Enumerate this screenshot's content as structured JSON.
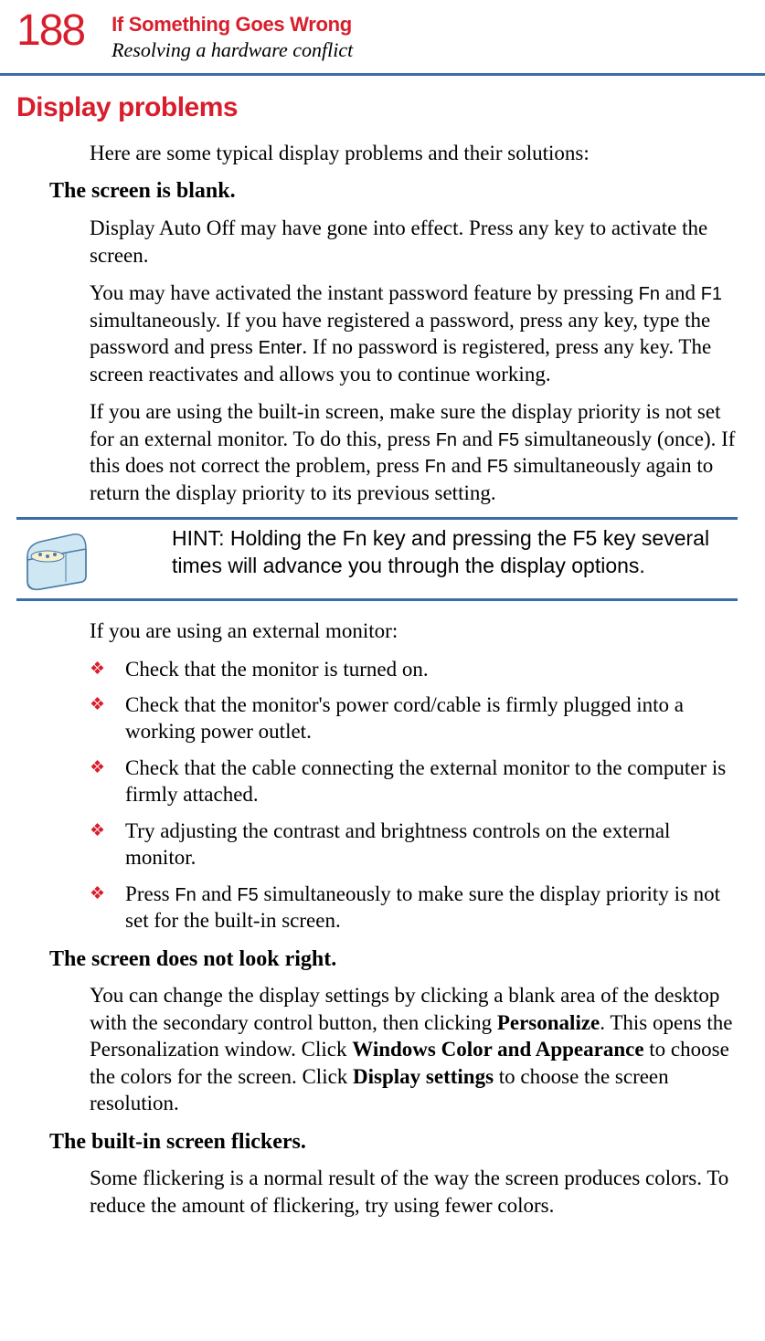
{
  "header": {
    "page_number": "188",
    "chapter_title": "If Something Goes Wrong",
    "section_subtitle": "Resolving a hardware conflict"
  },
  "heading": "Display problems",
  "intro": "Here are some typical display problems and their solutions:",
  "q1": "The screen is blank.",
  "p1": "Display Auto Off may have gone into effect. Press any key to activate the screen.",
  "p2a": "You may have activated the instant password feature by pressing ",
  "p2_fn": "Fn",
  "p2b": " and ",
  "p2_f1": "F1",
  "p2c": " simultaneously. If you have registered a password, press any key, type the password and press ",
  "p2_enter": "Enter",
  "p2d": ". If no password is registered, press any key. The screen reactivates and allows you to continue working.",
  "p3a": "If you are using the built-in screen, make sure the display priority is not set for an external monitor. To do this, press ",
  "p3_fn": "Fn",
  "p3b": " and ",
  "p3_f5": "F5",
  "p3c": " simultaneously (once). If this does not correct the problem, press ",
  "p3_fn2": "Fn",
  "p3d": " and ",
  "p3_f52": "F5",
  "p3e": " simultaneously again to return the display priority to its previous setting.",
  "hint": "HINT: Holding the Fn key and pressing the F5 key several times will advance you through the display options.",
  "p4": "If you are using an external monitor:",
  "bullets": {
    "b1": "Check that the monitor is turned on.",
    "b2": "Check that the monitor's power cord/cable is firmly plugged into a working power outlet.",
    "b3": "Check that the cable connecting the external monitor to the computer is firmly attached.",
    "b4": "Try adjusting the contrast and brightness controls on the external monitor.",
    "b5a": "Press ",
    "b5_fn": "Fn",
    "b5b": " and ",
    "b5_f5": "F5",
    "b5c": " simultaneously to make sure the display priority is not set for the built-in screen."
  },
  "q2": "The screen does not look right.",
  "p5a": "You can change the display settings by clicking a blank area of the desktop with the secondary control button, then clicking ",
  "p5_pers": "Personalize",
  "p5b": ". This opens the Personalization window. Click ",
  "p5_wca": "Windows Color and Appearance",
  "p5c": " to choose the colors for the screen. Click ",
  "p5_ds": "Display settings",
  "p5d": " to choose the screen resolution.",
  "q3": "The built-in screen flickers.",
  "p6": "Some flickering is a normal result of the way the screen produces colors. To reduce the amount of flickering, try using fewer colors."
}
